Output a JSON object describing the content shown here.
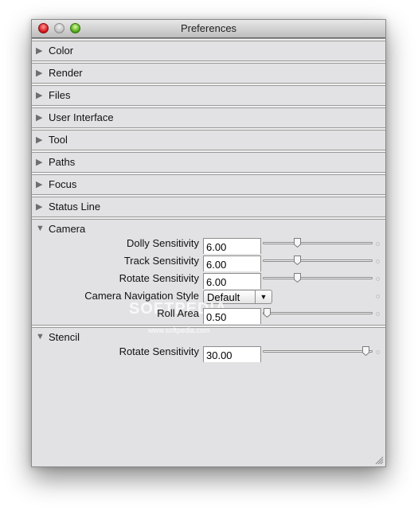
{
  "window": {
    "title": "Preferences"
  },
  "collapsed_sections": [
    {
      "label": "Color",
      "expanded": false
    },
    {
      "label": "Render",
      "expanded": false
    },
    {
      "label": "Files",
      "expanded": false
    },
    {
      "label": "User Interface",
      "expanded": false
    },
    {
      "label": "Tool",
      "expanded": false
    },
    {
      "label": "Paths",
      "expanded": false
    },
    {
      "label": "Focus",
      "expanded": false
    },
    {
      "label": "Status Line",
      "expanded": false
    }
  ],
  "camera": {
    "label": "Camera",
    "expanded": true,
    "dolly": {
      "label": "Dolly Sensitivity",
      "value": "6.00",
      "slider_fraction": 0.3
    },
    "track": {
      "label": "Track Sensitivity",
      "value": "6.00",
      "slider_fraction": 0.3
    },
    "rotate": {
      "label": "Rotate Sensitivity",
      "value": "6.00",
      "slider_fraction": 0.3
    },
    "nav_style": {
      "label": "Camera Navigation Style",
      "value": "Default"
    },
    "roll": {
      "label": "Roll Area",
      "value": "0.50",
      "slider_fraction": 0.0
    }
  },
  "stencil": {
    "label": "Stencil",
    "expanded": true,
    "rotate": {
      "label": "Rotate Sensitivity",
      "value": "30.00",
      "slider_fraction": 0.97
    }
  },
  "icons": {
    "collapsed": "▶",
    "expanded": "▼",
    "dropdown": "▼"
  },
  "watermark": {
    "big": "SOFTPEDIA",
    "url": "www.softpedia.com"
  }
}
